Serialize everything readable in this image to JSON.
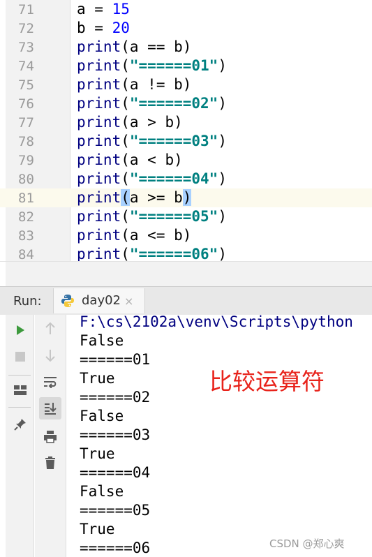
{
  "editor": {
    "lines": [
      {
        "num": "71",
        "tokens": [
          [
            "var",
            "a"
          ],
          [
            "op",
            " = "
          ],
          [
            "num",
            "15"
          ]
        ]
      },
      {
        "num": "72",
        "tokens": [
          [
            "var",
            "b"
          ],
          [
            "op",
            " = "
          ],
          [
            "num",
            "20"
          ]
        ]
      },
      {
        "num": "73",
        "tokens": [
          [
            "fn",
            "print"
          ],
          [
            "paren",
            "("
          ],
          [
            "var",
            "a"
          ],
          [
            "op",
            " == "
          ],
          [
            "var",
            "b"
          ],
          [
            "paren",
            ")"
          ]
        ]
      },
      {
        "num": "74",
        "tokens": [
          [
            "fn",
            "print"
          ],
          [
            "paren",
            "("
          ],
          [
            "str",
            "\"======01\""
          ],
          [
            "paren",
            ")"
          ]
        ]
      },
      {
        "num": "75",
        "tokens": [
          [
            "fn",
            "print"
          ],
          [
            "paren",
            "("
          ],
          [
            "var",
            "a"
          ],
          [
            "op",
            " != "
          ],
          [
            "var",
            "b"
          ],
          [
            "paren",
            ")"
          ]
        ]
      },
      {
        "num": "76",
        "tokens": [
          [
            "fn",
            "print"
          ],
          [
            "paren",
            "("
          ],
          [
            "str",
            "\"======02\""
          ],
          [
            "paren",
            ")"
          ]
        ]
      },
      {
        "num": "77",
        "tokens": [
          [
            "fn",
            "print"
          ],
          [
            "paren",
            "("
          ],
          [
            "var",
            "a"
          ],
          [
            "op",
            " > "
          ],
          [
            "var",
            "b"
          ],
          [
            "paren",
            ")"
          ]
        ]
      },
      {
        "num": "78",
        "tokens": [
          [
            "fn",
            "print"
          ],
          [
            "paren",
            "("
          ],
          [
            "str",
            "\"======03\""
          ],
          [
            "paren",
            ")"
          ]
        ]
      },
      {
        "num": "79",
        "tokens": [
          [
            "fn",
            "print"
          ],
          [
            "paren",
            "("
          ],
          [
            "var",
            "a"
          ],
          [
            "op",
            " < "
          ],
          [
            "var",
            "b"
          ],
          [
            "paren",
            ")"
          ]
        ]
      },
      {
        "num": "80",
        "tokens": [
          [
            "fn",
            "print"
          ],
          [
            "paren",
            "("
          ],
          [
            "str",
            "\"======04\""
          ],
          [
            "paren",
            ")"
          ]
        ]
      },
      {
        "num": "81",
        "current": true,
        "tokens": [
          [
            "fn",
            "print"
          ],
          [
            "hl",
            "("
          ],
          [
            "var",
            "a"
          ],
          [
            "op",
            " >= "
          ],
          [
            "var",
            "b"
          ],
          [
            "hl",
            ")"
          ]
        ]
      },
      {
        "num": "82",
        "tokens": [
          [
            "fn",
            "print"
          ],
          [
            "paren",
            "("
          ],
          [
            "str",
            "\"======05\""
          ],
          [
            "paren",
            ")"
          ]
        ]
      },
      {
        "num": "83",
        "tokens": [
          [
            "fn",
            "print"
          ],
          [
            "paren",
            "("
          ],
          [
            "var",
            "a"
          ],
          [
            "op",
            " <= "
          ],
          [
            "var",
            "b"
          ],
          [
            "paren",
            ")"
          ]
        ]
      },
      {
        "num": "84",
        "tokens": [
          [
            "fn",
            "print"
          ],
          [
            "paren",
            "("
          ],
          [
            "str",
            "\"======06\""
          ],
          [
            "paren",
            ")"
          ]
        ]
      }
    ]
  },
  "run_panel": {
    "label": "Run:",
    "tab_title": "day02",
    "tab_close": "×"
  },
  "console": {
    "lines": [
      "F:\\cs\\2102a\\venv\\Scripts\\python",
      "False",
      "======01",
      "True",
      "======02",
      "False",
      "======03",
      "True",
      "======04",
      "False",
      "======05",
      "True",
      "======06"
    ]
  },
  "annotation": "比较运算符",
  "watermark": "CSDN @郑心爽",
  "colors": {
    "keyword_fn": "#000080",
    "number": "#0000ff",
    "string": "#008080",
    "bracket_highlight": "#a8d1ff",
    "current_line": "#fcfaed",
    "annotation": "#e8231b",
    "run_green": "#3d9a3d"
  },
  "icons": {
    "run": "run-triangle-icon",
    "stop": "stop-square-icon",
    "layout": "layout-icon",
    "pin": "pin-icon",
    "up": "arrow-up-icon",
    "down": "arrow-down-icon",
    "wrap": "soft-wrap-icon",
    "scroll_end": "scroll-to-end-icon",
    "print": "print-icon",
    "trash": "trash-icon",
    "python": "python-icon"
  }
}
